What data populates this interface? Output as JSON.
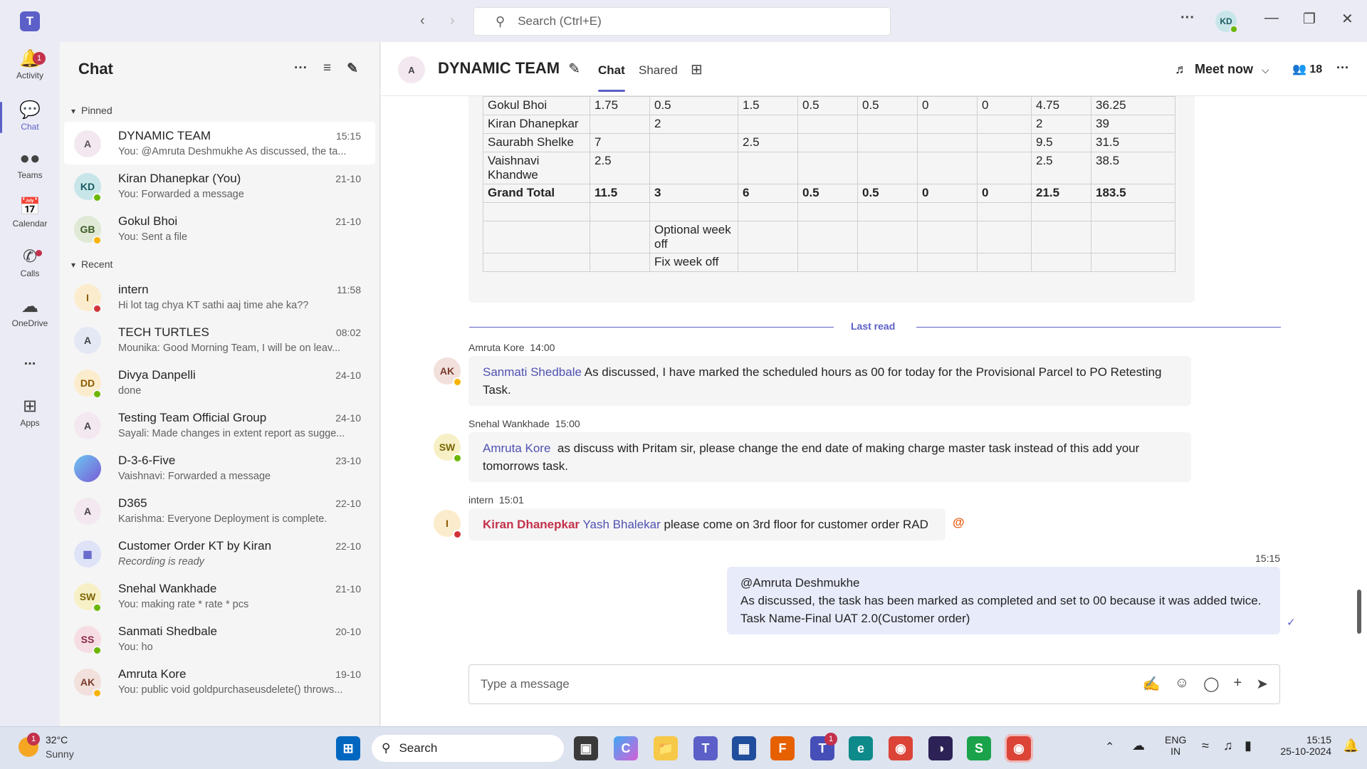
{
  "titlebar": {
    "search_placeholder": "Search (Ctrl+E)",
    "user_initials": "KD",
    "back": "‹",
    "forward": "›",
    "more": "···",
    "minimize": "—",
    "restore": "❐",
    "close": "✕"
  },
  "rail": {
    "items": [
      {
        "label": "Activity",
        "badge": "1"
      },
      {
        "label": "Chat"
      },
      {
        "label": "Teams"
      },
      {
        "label": "Calendar"
      },
      {
        "label": "Calls"
      },
      {
        "label": "OneDrive"
      },
      {
        "label": "..."
      },
      {
        "label": "Apps"
      }
    ]
  },
  "chatlist": {
    "title": "Chat",
    "pinned_label": "Pinned",
    "recent_label": "Recent",
    "pinned": [
      {
        "name": "DYNAMIC TEAM",
        "time": "15:15",
        "preview": "You: @Amruta Deshmukhe As discussed, the ta...",
        "initials": "A"
      },
      {
        "name": "Kiran Dhanepkar (You)",
        "time": "21-10",
        "preview": "You: Forwarded a message",
        "initials": "KD"
      },
      {
        "name": "Gokul Bhoi",
        "time": "21-10",
        "preview": "You: Sent a file",
        "initials": "GB"
      }
    ],
    "recent": [
      {
        "name": "intern",
        "time": "11:58",
        "preview": "Hi lot tag chya KT sathi aaj time ahe ka??",
        "initials": "I"
      },
      {
        "name": "TECH TURTLES",
        "time": "08:02",
        "preview": "Mounika: Good Morning Team, I will be on leav...",
        "initials": "A"
      },
      {
        "name": "Divya Danpelli",
        "time": "24-10",
        "preview": "done",
        "initials": "DD"
      },
      {
        "name": "Testing Team Official Group",
        "time": "24-10",
        "preview": "Sayali: Made changes in extent report as sugge...",
        "initials": "A"
      },
      {
        "name": "D-3-6-Five",
        "time": "23-10",
        "preview": "Vaishnavi: Forwarded a message",
        "initials": ""
      },
      {
        "name": "D365",
        "time": "22-10",
        "preview": "Karishma: Everyone  Deployment is complete.",
        "initials": "A"
      },
      {
        "name": "Customer Order KT by Kiran",
        "time": "22-10",
        "preview": "Recording is ready",
        "initials": "▦"
      },
      {
        "name": "Snehal Wankhade",
        "time": "21-10",
        "preview": "You: making rate  * rate * pcs",
        "initials": "SW"
      },
      {
        "name": "Sanmati Shedbale",
        "time": "20-10",
        "preview": "You: ho",
        "initials": "SS"
      },
      {
        "name": "Amruta Kore",
        "time": "19-10",
        "preview": "You: public void goldpurchaseusdelete() throws...",
        "initials": "AK"
      }
    ]
  },
  "header": {
    "title": "DYNAMIC TEAM",
    "tab_chat": "Chat",
    "tab_shared": "Shared",
    "meet_now": "Meet now",
    "people_count": "18",
    "group_initial": "A"
  },
  "table": {
    "rows": [
      {
        "bold": false,
        "cells": [
          "Gokul Bhoi",
          "1.75",
          "0.5",
          "1.5",
          "0.5",
          "0.5",
          "0",
          "0",
          "4.75",
          "36.25"
        ]
      },
      {
        "bold": false,
        "cells": [
          "Kiran Dhanepkar",
          "",
          "2",
          "",
          "",
          "",
          "",
          "",
          "2",
          "39"
        ]
      },
      {
        "bold": false,
        "cells": [
          "Saurabh Shelke",
          "7",
          "",
          "2.5",
          "",
          "",
          "",
          "",
          "9.5",
          "31.5"
        ]
      },
      {
        "bold": false,
        "cells": [
          "Vaishnavi Khandwe",
          "2.5",
          "",
          "",
          "",
          "",
          "",
          "",
          "2.5",
          "38.5"
        ]
      },
      {
        "bold": true,
        "cells": [
          "Grand Total",
          "11.5",
          "3",
          "6",
          "0.5",
          "0.5",
          "0",
          "0",
          "21.5",
          "183.5"
        ]
      },
      {
        "bold": false,
        "cells": [
          "",
          "",
          "",
          "",
          "",
          "",
          "",
          "",
          "",
          ""
        ]
      },
      {
        "bold": false,
        "cells": [
          "",
          "",
          "Optional week off",
          "",
          "",
          "",
          "",
          "",
          "",
          ""
        ]
      },
      {
        "bold": false,
        "cells": [
          "",
          "",
          "Fix week off",
          "",
          "",
          "",
          "",
          "",
          "",
          ""
        ]
      }
    ]
  },
  "last_read": "Last read",
  "messages": [
    {
      "author": "Amruta Kore",
      "time": "14:00",
      "initials": "AK",
      "mention": "Sanmati Shedbale",
      "text": "As discussed, I have marked the scheduled hours as 00 for today for the Provisional Parcel to PO Retesting Task."
    },
    {
      "author": "Snehal Wankhade",
      "time": "15:00",
      "initials": "SW",
      "mention": "Amruta Kore",
      "text": "as discuss with Pritam sir, please change the end  date of making charge master task instead  of this add  your tomorrows task."
    },
    {
      "author": "intern",
      "time": "15:01",
      "initials": "I",
      "mention_me": "Kiran Dhanepkar",
      "mention": "Yash Bhalekar",
      "text": "please come on 3rd floor for customer order RAD",
      "at": "@"
    }
  ],
  "my_message": {
    "time": "15:15",
    "line1": "@Amruta Deshmukhe",
    "line2": "As discussed, the task has been marked as completed and set to 00 because it was added twice.",
    "line3": "Task Name-Final UAT 2.0(Customer order)"
  },
  "compose": {
    "placeholder": "Type a message"
  },
  "taskbar": {
    "weather_temp": "32°C",
    "weather_desc": "Sunny",
    "weather_badge": "1",
    "search_label": "Search",
    "lang1": "ENG",
    "lang2": "IN",
    "time": "15:15",
    "date": "25-10-2024",
    "teams_badge": "1"
  }
}
